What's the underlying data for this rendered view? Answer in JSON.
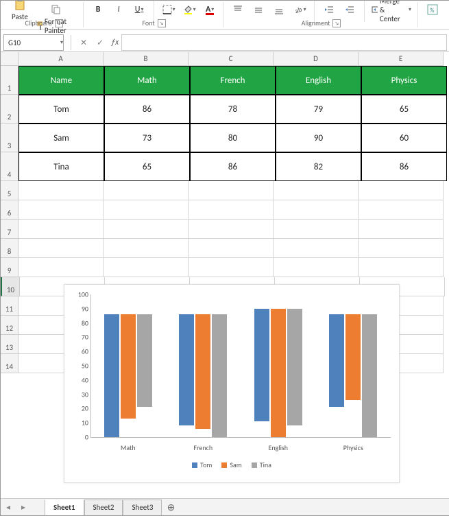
{
  "ribbon": {
    "paste": {
      "label": "Paste",
      "paint": "Format Painter"
    },
    "clipboard": {
      "label": "Clipboard"
    },
    "font": {
      "bold": "B",
      "italic": "I",
      "underline": "U",
      "label": "Font"
    },
    "align": {
      "merge": "Merge & Center",
      "label": "Alignment"
    }
  },
  "namebox": "G10",
  "columns": [
    "A",
    "B",
    "C",
    "D",
    "E"
  ],
  "rows": [
    "1",
    "2",
    "3",
    "4",
    "5",
    "6",
    "7",
    "8",
    "9",
    "10",
    "11",
    "12",
    "13",
    "14"
  ],
  "table": {
    "headers": [
      "Name",
      "Math",
      "French",
      "English",
      "Physics"
    ],
    "rows": [
      {
        "name": "Tom",
        "vals": [
          "86",
          "78",
          "79",
          "65"
        ]
      },
      {
        "name": "Sam",
        "vals": [
          "73",
          "80",
          "90",
          "60"
        ]
      },
      {
        "name": "Tina",
        "vals": [
          "65",
          "86",
          "82",
          "86"
        ]
      }
    ]
  },
  "chart_data": {
    "type": "bar",
    "categories": [
      "Math",
      "French",
      "English",
      "Physics"
    ],
    "series": [
      {
        "name": "Tom",
        "values": [
          86,
          78,
          79,
          65
        ]
      },
      {
        "name": "Sam",
        "values": [
          73,
          80,
          90,
          60
        ]
      },
      {
        "name": "Tina",
        "values": [
          65,
          86,
          82,
          86
        ]
      }
    ],
    "ylim": [
      0,
      100
    ],
    "ystep": 10,
    "yticks": [
      0,
      10,
      20,
      30,
      40,
      50,
      60,
      70,
      80,
      90,
      100
    ]
  },
  "sheets": {
    "active": "Sheet1",
    "tabs": [
      "Sheet1",
      "Sheet2",
      "Sheet3"
    ]
  }
}
